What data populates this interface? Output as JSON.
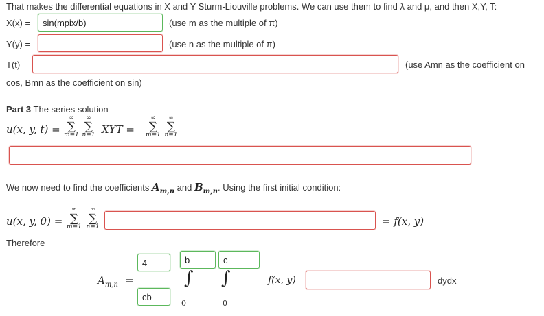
{
  "intro_text": "That makes the differential equations in X and Y Sturm-Liouville problems. We can use them to find λ and μ, and then X,Y, T:",
  "x_row": {
    "label": "X(x) =",
    "value": "sin(mpix/b)",
    "hint": "(use m as the multiple of π)"
  },
  "y_row": {
    "label": "Y(y) =",
    "value": "",
    "hint": "(use n as the multiple of π)"
  },
  "t_row": {
    "label": "T(t) =",
    "value": "",
    "hint": "(use Amn as the coefficient on",
    "hint_cont": "cos, Bmn as the coefficient on sin)"
  },
  "part3": {
    "heading_bold": "Part 3",
    "heading_rest": " The series solution",
    "lhs": "u(x, y, t) =",
    "sum_top": "∞",
    "sum_bottom_m": "m=1",
    "sum_bottom_n": "n=1",
    "xyt": "XYT =",
    "answer_value": ""
  },
  "coeff_text_1": "We now need to find the coefficients",
  "coeff_amn": "A",
  "coeff_amn_sub": "m,n",
  "coeff_and": "and",
  "coeff_bmn": "B",
  "coeff_bmn_sub": "m,n",
  "coeff_text_2": ". Using the first initial condition:",
  "initial": {
    "lhs": "u(x, y, 0) =",
    "answer_value": "",
    "rhs": "= f(x, y)"
  },
  "therefore": "Therefore",
  "final": {
    "amn": "A",
    "amn_sub": "m,n",
    "eq": "=",
    "numerator_value": "4",
    "denominator_value": "cb",
    "upper_limit_1": "b",
    "upper_limit_2": "c",
    "lower_limit_1": "0",
    "lower_limit_2": "0",
    "fxy": "f(x, y)",
    "integrand_value": "",
    "dydx": "dydx"
  }
}
